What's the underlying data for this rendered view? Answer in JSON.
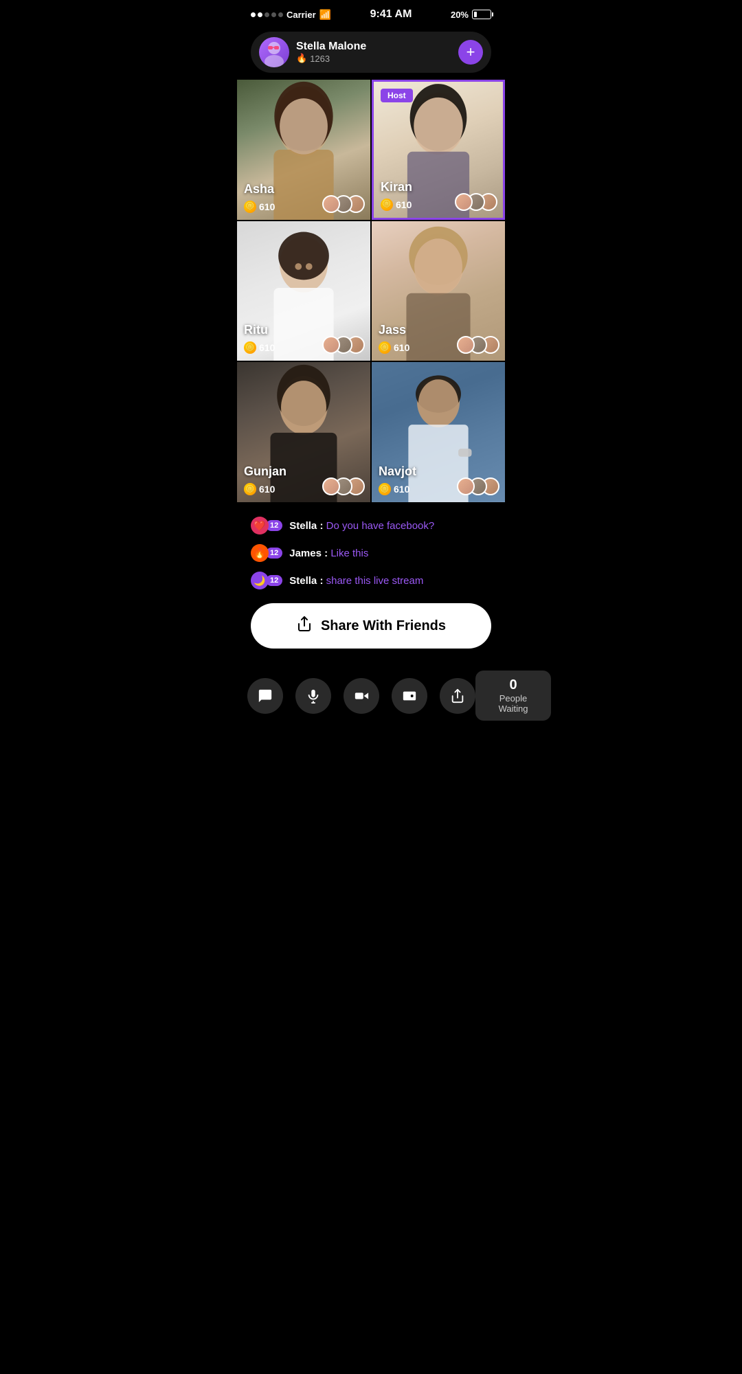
{
  "statusBar": {
    "carrier": "Carrier",
    "time": "9:41 AM",
    "battery": "20%",
    "signal": [
      true,
      true,
      false,
      false,
      false
    ]
  },
  "profile": {
    "name": "Stella Malone",
    "score": "1263",
    "addLabel": "+"
  },
  "grid": [
    {
      "name": "Asha",
      "score": "610",
      "bgClass": "bg-asha",
      "isHost": false
    },
    {
      "name": "Kiran",
      "score": "610",
      "bgClass": "bg-kiran",
      "isHost": true,
      "hostLabel": "Host"
    },
    {
      "name": "Ritu",
      "score": "610",
      "bgClass": "bg-ritu",
      "isHost": false
    },
    {
      "name": "Jass",
      "score": "610",
      "bgClass": "bg-jass",
      "isHost": false
    },
    {
      "name": "Gunjan",
      "score": "610",
      "bgClass": "bg-gunjan",
      "isHost": false
    },
    {
      "name": "Navjot",
      "score": "610",
      "bgClass": "bg-navjot",
      "isHost": false
    }
  ],
  "chat": [
    {
      "icon": "❤️",
      "iconBg": "#e03060",
      "badge": "12",
      "sender": "Stella",
      "message": "Do you have facebook?"
    },
    {
      "icon": "🔥",
      "iconBg": "#ff5500",
      "badge": "12",
      "sender": "James",
      "message": "Like this"
    },
    {
      "icon": "🌙",
      "iconBg": "#8B44E8",
      "badge": "12",
      "sender": "Stella",
      "message": "share this live stream"
    }
  ],
  "shareButton": {
    "label": "Share With Friends"
  },
  "bottomBar": {
    "actions": [
      {
        "name": "chat-button",
        "icon": "💬"
      },
      {
        "name": "mic-button",
        "icon": "🎤"
      },
      {
        "name": "video-button",
        "icon": "🎥"
      },
      {
        "name": "wallet-button",
        "icon": "👛"
      },
      {
        "name": "share-button",
        "icon": "📤"
      }
    ],
    "peopleWaiting": {
      "count": "0",
      "label": "People Waiting"
    }
  },
  "colors": {
    "purple": "#8B44E8",
    "bg": "#000000",
    "card": "#1a1a1a",
    "coin": "#ffd700"
  }
}
